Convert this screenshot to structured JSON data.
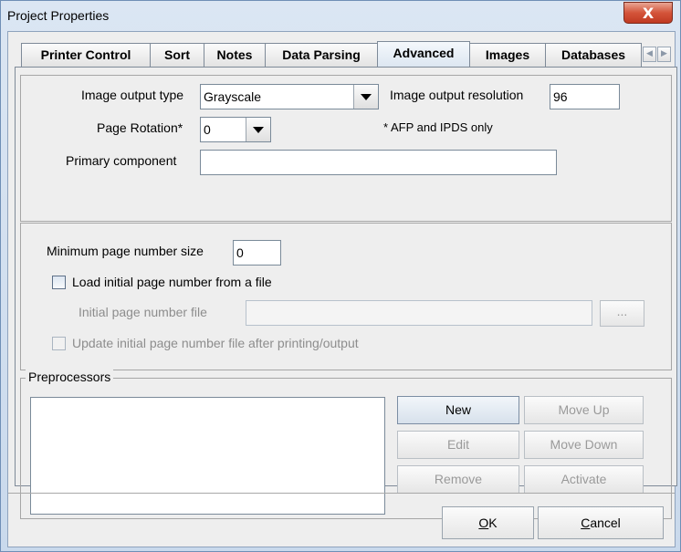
{
  "window": {
    "title": "Project Properties",
    "close_glyph": "X"
  },
  "tabs": [
    {
      "label": "Printer Control"
    },
    {
      "label": "Sort"
    },
    {
      "label": "Notes"
    },
    {
      "label": "Data Parsing"
    },
    {
      "label": "Advanced",
      "active": true
    },
    {
      "label": "Images"
    },
    {
      "label": "Databases"
    }
  ],
  "tab_scroll": {
    "left_glyph": "◀",
    "right_glyph": "▶"
  },
  "image_section": {
    "output_type_label": "Image output type",
    "output_type_value": "Grayscale",
    "resolution_label": "Image output resolution",
    "resolution_value": "96",
    "rotation_label": "Page Rotation*",
    "rotation_value": "0",
    "afp_note": "* AFP and IPDS only",
    "primary_component_label": "Primary component",
    "primary_component_value": ""
  },
  "page_number_section": {
    "min_size_label": "Minimum page number size",
    "min_size_value": "0",
    "load_from_file_label": "Load initial page number from a file",
    "load_from_file_checked": false,
    "initial_file_label": "Initial page number file",
    "initial_file_value": "",
    "browse_label": "...",
    "update_file_label": "Update initial page number file after printing/output",
    "update_file_checked": false
  },
  "preprocessors": {
    "legend": "Preprocessors",
    "items": [],
    "new_label": "New",
    "move_up_label": "Move Up",
    "edit_label": "Edit",
    "move_down_label": "Move Down",
    "remove_label": "Remove",
    "activate_label": "Activate"
  },
  "footer": {
    "ok_mnemonic": "O",
    "ok_rest": "K",
    "cancel_mnemonic": "C",
    "cancel_rest": "ancel"
  }
}
